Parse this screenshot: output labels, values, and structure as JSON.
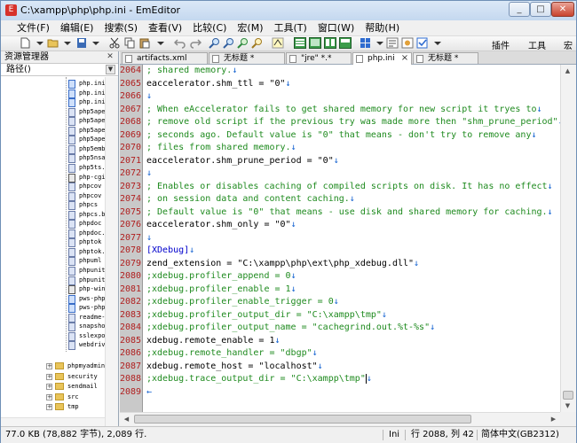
{
  "window": {
    "title": "C:\\xampp\\php\\php.ini - EmEditor"
  },
  "menu": [
    "文件(F)",
    "编辑(E)",
    "搜索(S)",
    "查看(V)",
    "比较(C)",
    "宏(M)",
    "工具(T)",
    "窗口(W)",
    "帮助(H)"
  ],
  "toolbar": {
    "plugins_label": "插件",
    "tools_label": "工具",
    "macro_label": "宏"
  },
  "sidebar": {
    "title": "资源管理器",
    "path_label": "路径()",
    "files": [
      "php.ini",
      "php.ini",
      "php.ini",
      "php5ape",
      "php5ape",
      "php5ape",
      "php5ape",
      "php5emb",
      "php5nsa",
      "php5ts.",
      "php-cgi",
      "phpcov",
      "phpcov",
      "phpcs",
      "phpcs.b",
      "phpdoc",
      "phpdoc.",
      "phptok",
      "phptok.",
      "phpuml",
      "phpunit",
      "phpunit",
      "php-win",
      "pws-php",
      "pws-php",
      "readme-",
      "snapsho",
      "sslexpo",
      "webdriv"
    ],
    "folders": [
      "phpmyadmin",
      "security",
      "sendmail",
      "src",
      "tmp"
    ]
  },
  "tabs": [
    {
      "label": "artifacts.xml",
      "active": false
    },
    {
      "label": "无标题 *",
      "active": false
    },
    {
      "label": "\"jre\" *.*",
      "active": false
    },
    {
      "label": "php.ini",
      "active": true
    },
    {
      "label": "无标题 *",
      "active": false
    }
  ],
  "editor": {
    "lines": [
      {
        "n": "2064",
        "t": "; shared memory.",
        "k": "c"
      },
      {
        "n": "2065",
        "t": "eaccelerator.shm_ttl = \"0\"",
        "k": "s"
      },
      {
        "n": "2066",
        "t": "",
        "k": "s"
      },
      {
        "n": "2067",
        "t": "; When eAccelerator fails to get shared memory for new script it tryes to",
        "k": "c"
      },
      {
        "n": "2068",
        "t": "; remove old script if the previous try was made more then \"shm_prune_period\"",
        "k": "c"
      },
      {
        "n": "2069",
        "t": "; seconds ago. Default value is \"0\" that means - don't try to remove any",
        "k": "c"
      },
      {
        "n": "2070",
        "t": "; files from shared memory.",
        "k": "c"
      },
      {
        "n": "2071",
        "t": "eaccelerator.shm_prune_period = \"0\"",
        "k": "s"
      },
      {
        "n": "2072",
        "t": "",
        "k": "s"
      },
      {
        "n": "2073",
        "t": "; Enables or disables caching of compiled scripts on disk. It has no effect",
        "k": "c"
      },
      {
        "n": "2074",
        "t": "; on session data and content caching.",
        "k": "c"
      },
      {
        "n": "2075",
        "t": "; Default value is \"0\" that means - use disk and shared memory for caching.",
        "k": "c"
      },
      {
        "n": "2076",
        "t": "eaccelerator.shm_only = \"0\"",
        "k": "s"
      },
      {
        "n": "2077",
        "t": "",
        "k": "s"
      },
      {
        "n": "2078",
        "t": "[XDebug]",
        "k": "sec"
      },
      {
        "n": "2079",
        "t": "zend_extension = \"C:\\xampp\\php\\ext\\php_xdebug.dll\"",
        "k": "s"
      },
      {
        "n": "2080",
        "t": ";xdebug.profiler_append = 0",
        "k": "c"
      },
      {
        "n": "2081",
        "t": ";xdebug.profiler_enable = 1",
        "k": "c"
      },
      {
        "n": "2082",
        "t": ";xdebug.profiler_enable_trigger = 0",
        "k": "c"
      },
      {
        "n": "2083",
        "t": ";xdebug.profiler_output_dir = \"C:\\xampp\\tmp\"",
        "k": "c"
      },
      {
        "n": "2084",
        "t": ";xdebug.profiler_output_name = \"cachegrind.out.%t-%s\"",
        "k": "c"
      },
      {
        "n": "2085",
        "t": "xdebug.remote_enable = 1",
        "k": "s"
      },
      {
        "n": "2086",
        "t": ";xdebug.remote_handler = \"dbgp\"",
        "k": "c"
      },
      {
        "n": "2087",
        "t": "xdebug.remote_host = \"localhost\"",
        "k": "s"
      },
      {
        "n": "2088",
        "t": ";xdebug.trace_output_dir = \"C:\\xampp\\tmp\"",
        "k": "c"
      },
      {
        "n": "2089",
        "t": "",
        "k": "s"
      }
    ],
    "newline_mark": "↓",
    "eof_mark": "←"
  },
  "status": {
    "size": "77.0 KB (78,882 字节), 2,089 行.",
    "mode": "Ini",
    "position": "行 2088, 列 42",
    "encoding": "简体中文(GB2312)"
  }
}
